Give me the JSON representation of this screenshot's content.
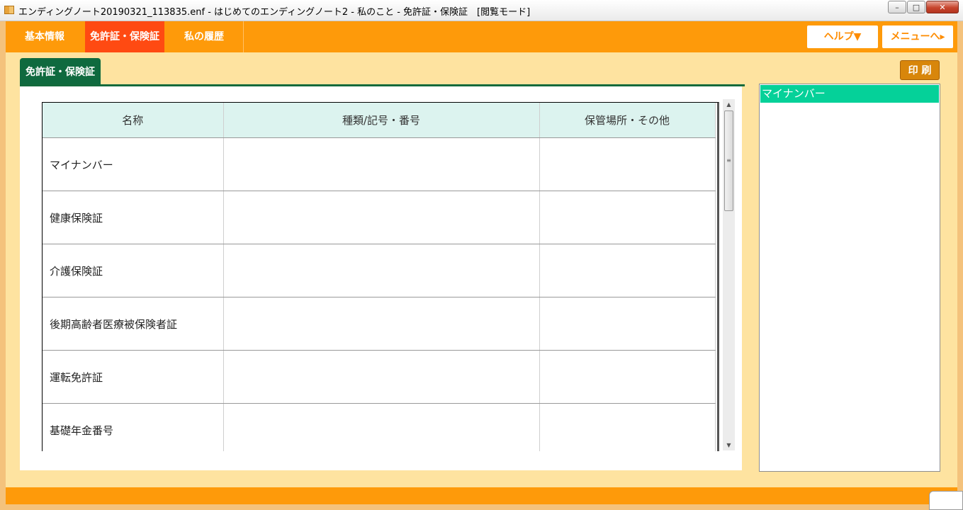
{
  "window": {
    "title": "エンディングノート20190321_113835.enf - はじめてのエンディングノート2 - 私のこと - 免許証・保険証　[閲覧モード]",
    "minimize_icon": "minimize-icon",
    "maximize_icon": "maximize-icon",
    "close_icon": "close-icon"
  },
  "nav": {
    "tabs": [
      {
        "label": "基本情報"
      },
      {
        "label": "免許証・保険証",
        "active": true
      },
      {
        "label": "私の履歴"
      }
    ],
    "help_label": "ヘルプ▼",
    "menu_label": "メニューへ▸"
  },
  "section": {
    "tab_label": "免許証・保険証",
    "print_label": "印 刷"
  },
  "table": {
    "headers": [
      "名称",
      "種類/記号・番号",
      "保管場所・その他"
    ],
    "rows": [
      {
        "name": "マイナンバー",
        "type": "",
        "location": ""
      },
      {
        "name": "健康保険証",
        "type": "",
        "location": ""
      },
      {
        "name": "介護保険証",
        "type": "",
        "location": ""
      },
      {
        "name": "後期高齢者医療被保険者証",
        "type": "",
        "location": ""
      },
      {
        "name": "運転免許証",
        "type": "",
        "location": ""
      },
      {
        "name": "基礎年金番号",
        "type": "",
        "location": ""
      },
      {
        "name": "",
        "type": "",
        "location": ""
      }
    ]
  },
  "side_panel": {
    "selected_item": "マイナンバー"
  },
  "colors": {
    "nav_bg": "#fe9a0a",
    "nav_active": "#ff4a12",
    "tab_green": "#0f6a3f",
    "header_bg": "#dcf3ef",
    "side_selected": "#05d199"
  }
}
